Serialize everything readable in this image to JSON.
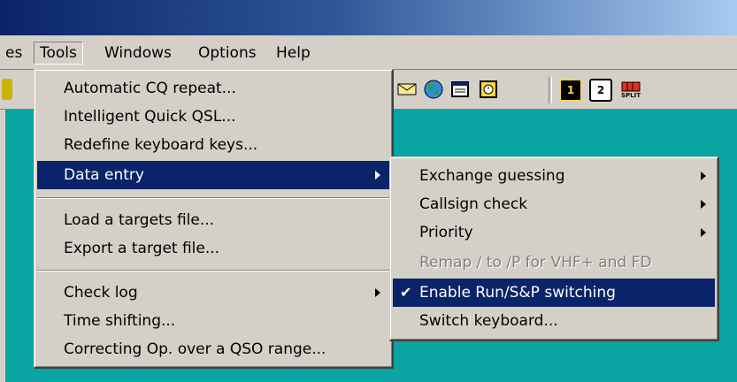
{
  "menubar": {
    "items": [
      {
        "label": "es"
      },
      {
        "label": "Tools"
      },
      {
        "label": "Windows"
      },
      {
        "label": "Options"
      },
      {
        "label": "Help"
      }
    ]
  },
  "toolbar": {
    "icons": [
      "mail-icon",
      "globe-icon",
      "window-icon",
      "alarm-icon",
      "radio1-icon",
      "radio2-icon",
      "split-icon"
    ],
    "radio1": "1",
    "radio2": "2",
    "split": "SPLIT"
  },
  "tools_menu": {
    "items": [
      {
        "label": "Automatic CQ repeat..."
      },
      {
        "label": "Intelligent Quick QSL..."
      },
      {
        "label": "Redefine keyboard keys..."
      },
      {
        "label": "Data entry",
        "submenu": true,
        "selected": true
      },
      {
        "label": "Load a targets file..."
      },
      {
        "label": "Export a target file..."
      },
      {
        "label": "Check log",
        "submenu": true
      },
      {
        "label": "Time shifting..."
      },
      {
        "label": "Correcting Op. over a QSO range..."
      }
    ]
  },
  "data_entry_menu": {
    "items": [
      {
        "label": "Exchange guessing",
        "submenu": true
      },
      {
        "label": "Callsign check",
        "submenu": true
      },
      {
        "label": "Priority",
        "submenu": true
      },
      {
        "label": "Remap / to /P for VHF+ and FD",
        "disabled": true
      },
      {
        "label": "Enable Run/S&P switching",
        "checked": true,
        "selected": true
      },
      {
        "label": "Switch keyboard..."
      }
    ]
  },
  "colors": {
    "title_gradient_start": "#0a246a",
    "menu_highlight": "#0a246a",
    "workspace": "#0aa5a2",
    "menu_face": "#d4d0c8"
  }
}
